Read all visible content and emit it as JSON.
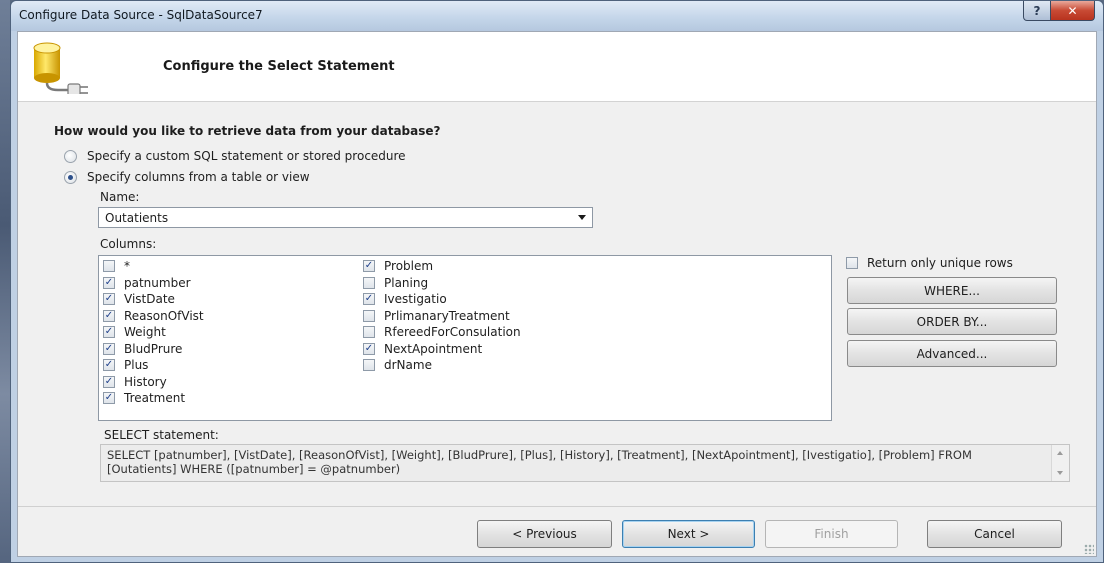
{
  "window": {
    "title": "Configure Data Source - SqlDataSource7",
    "help_glyph": "?",
    "close_glyph": "✕"
  },
  "banner": {
    "icon": "database-connection-icon",
    "title": "Configure the Select Statement"
  },
  "question": "How would you like to retrieve data from your database?",
  "options": [
    {
      "label": "Specify a custom SQL statement or stored procedure",
      "selected": false
    },
    {
      "label": "Specify columns from a table or view",
      "selected": true
    }
  ],
  "name_field": {
    "label": "Name:",
    "value": "Outatients"
  },
  "columns": {
    "label": "Columns:",
    "left": [
      {
        "name": "*",
        "checked": false
      },
      {
        "name": "patnumber",
        "checked": true
      },
      {
        "name": "VistDate",
        "checked": true
      },
      {
        "name": "ReasonOfVist",
        "checked": true
      },
      {
        "name": "Weight",
        "checked": true
      },
      {
        "name": "BludPrure",
        "checked": true
      },
      {
        "name": "Plus",
        "checked": true
      },
      {
        "name": "History",
        "checked": true
      },
      {
        "name": "Treatment",
        "checked": true
      }
    ],
    "right": [
      {
        "name": "Problem",
        "checked": true
      },
      {
        "name": "Planing",
        "checked": false
      },
      {
        "name": "Ivestigatio",
        "checked": true
      },
      {
        "name": "PrlimanaryTreatment",
        "checked": false
      },
      {
        "name": "RfereedForConsulation",
        "checked": false
      },
      {
        "name": "NextApointment",
        "checked": true
      },
      {
        "name": "drName",
        "checked": false
      }
    ]
  },
  "unique_rows": {
    "label": "Return only unique rows",
    "checked": false
  },
  "side_buttons": {
    "where": "WHERE...",
    "order_by": "ORDER BY...",
    "advanced": "Advanced..."
  },
  "sql": {
    "label": "SELECT statement:",
    "text": "SELECT [patnumber], [VistDate], [ReasonOfVist], [Weight], [BludPrure], [Plus], [History], [Treatment], [NextApointment], [Ivestigatio], [Problem] FROM [Outatients] WHERE ([patnumber] = @patnumber)"
  },
  "nav_buttons": {
    "previous": "< Previous",
    "next": "Next >",
    "finish": "Finish",
    "cancel": "Cancel"
  },
  "colors": {
    "title_bar": "#c5d6ea",
    "close_button": "#c84a34",
    "check_mark": "#1e3f8a",
    "default_button_border": "#3c7fb1"
  }
}
